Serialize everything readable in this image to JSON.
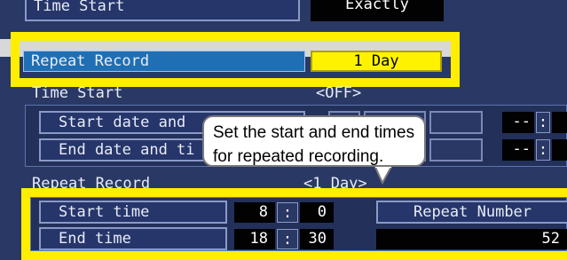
{
  "settings": {
    "time_start_label": "Time Start",
    "time_start_value": "Exactly",
    "repeat_record_label": "Repeat Record",
    "repeat_record_value": "1 Day"
  },
  "time_start_section": {
    "header": "Time Start",
    "state": "<OFF>",
    "start_row_label": "Start date and",
    "end_row_label": "End date and ti",
    "placeholder_1": "--",
    "placeholder_2": "--",
    "colon": ":"
  },
  "repeat_section": {
    "header": "Repeat Record",
    "state": "<1 Day>",
    "start_time_label": "Start time",
    "end_time_label": "End time",
    "start_hour": "8",
    "start_minute": "0",
    "end_hour": "18",
    "end_minute": "30",
    "colon": ":",
    "repeat_number_label": "Repeat Number",
    "repeat_number_value": "52"
  },
  "callout": {
    "text": "Set the start and end times for repeated recording."
  },
  "colors": {
    "background": "#2a3865",
    "highlight": "#ffee00",
    "selected_row": "#1f6fb4",
    "value_box": "#020202"
  }
}
